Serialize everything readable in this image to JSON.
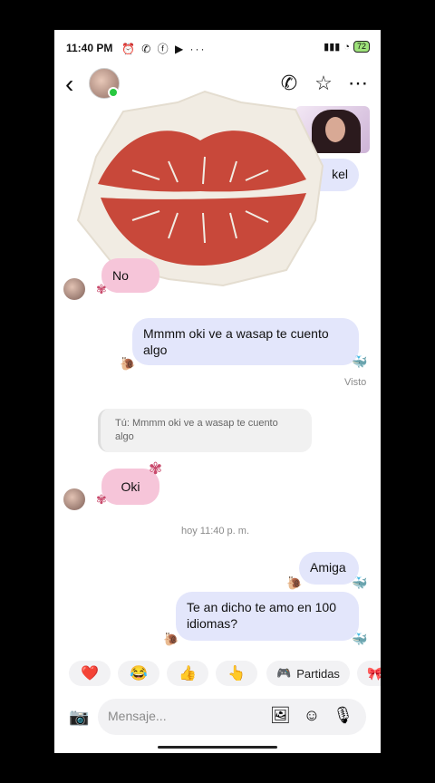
{
  "status": {
    "time": "11:40 PM",
    "notif_icons": "⏰ ✆ ⓕ ▶ ···",
    "battery": "72"
  },
  "header": {
    "contact_name": "",
    "icons": [
      "back-arrow-icon",
      "phone-icon",
      "star-icon",
      "more-icon"
    ]
  },
  "messages": {
    "partial_out": "kel",
    "in_no": "No",
    "out_oki": "Mmmm oki  ve a wasap te cuento algo",
    "seen": "Visto",
    "reply_quote": "Tú: Mmmm oki  ve a wasap te cuento algo",
    "in_oki": "Oki",
    "timestamp": "hoy 11:40 p. m.",
    "out_amiga": "Amiga",
    "out_question": "Te an dicho te amo en 100 idiomas?"
  },
  "reactions": {
    "heart": "❤️",
    "laugh": "😂",
    "thumbs": "👍",
    "point": "👆",
    "games_label": "Partidas"
  },
  "composer": {
    "placeholder": "Mensaje..."
  },
  "colors": {
    "outgoing_bubble": "#e3e6fb",
    "incoming_bubble": "#f6c5d9",
    "lips": "#c8483a"
  }
}
